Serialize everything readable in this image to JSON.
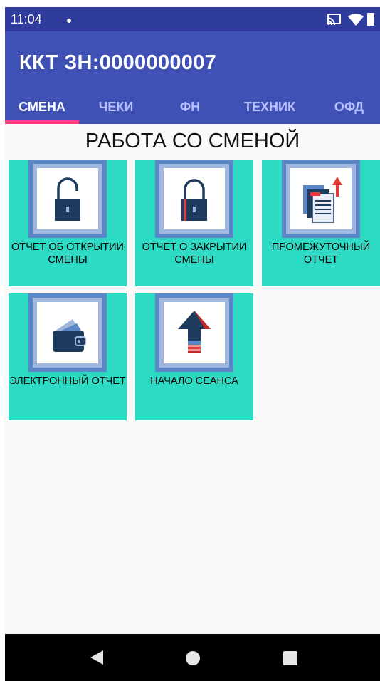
{
  "status_bar": {
    "time": "11:04",
    "icons": [
      "notification-dot-icon",
      "cast-icon",
      "wifi-icon",
      "battery-icon"
    ]
  },
  "app_bar": {
    "title": "ККТ ЗН:0000000007",
    "tabs": [
      {
        "label": "СМЕНА",
        "active": true
      },
      {
        "label": "ЧЕКИ",
        "active": false
      },
      {
        "label": "ФН",
        "active": false
      },
      {
        "label": "ТЕХНИК",
        "active": false
      },
      {
        "label": "ОФД",
        "active": false
      }
    ]
  },
  "section": {
    "title": "РАБОТА СО СМЕНОЙ"
  },
  "tiles": [
    {
      "label": "ОТЧЕТ ОБ ОТКРЫТИИ СМЕНЫ",
      "icon": "open-padlock-icon"
    },
    {
      "label": "ОТЧЕТ О ЗАКРЫТИИ СМЕНЫ",
      "icon": "closed-padlock-icon"
    },
    {
      "label": "ПРОМЕЖУТОЧНЫЙ ОТЧЕТ",
      "icon": "documents-upload-icon"
    },
    {
      "label": "ЭЛЕКТРОННЫЙ ОТЧЕТ",
      "icon": "wallet-icon"
    },
    {
      "label": "НАЧАЛО СЕАНСА",
      "icon": "upload-arrow-icon"
    }
  ],
  "colors": {
    "status_bar": "#2f3c9e",
    "app_bar": "#3f51b5",
    "tab_indicator": "#ff4081",
    "tile_background": "#2ddbc5",
    "icon_frame": "#5b87c6",
    "icon_dark": "#1f3b5e",
    "icon_accent_red": "#e53935"
  },
  "nav_bar": {
    "icons": [
      "back-icon",
      "home-icon",
      "recent-apps-icon"
    ]
  }
}
